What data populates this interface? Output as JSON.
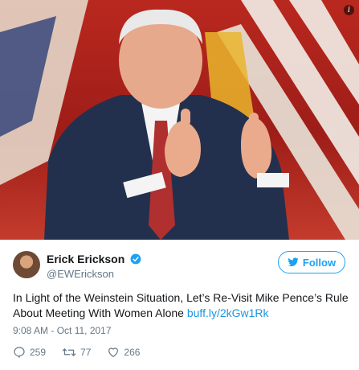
{
  "tweet": {
    "author_name": "Erick Erickson",
    "author_handle": "@EWErickson",
    "follow_label": "Follow",
    "text": "In Light of the Weinstein Situation, Let’s Re-Visit Mike Pence’s Rule About Meeting With Women Alone",
    "link": "buff.ly/2kGw1Rk",
    "timestamp": "9:08 AM - Oct 11, 2017",
    "replies": "259",
    "retweets": "77",
    "likes": "266"
  },
  "colors": {
    "accent": "#1da1f2",
    "link": "#1b95e0",
    "muted": "#657786",
    "text": "#14171a"
  }
}
